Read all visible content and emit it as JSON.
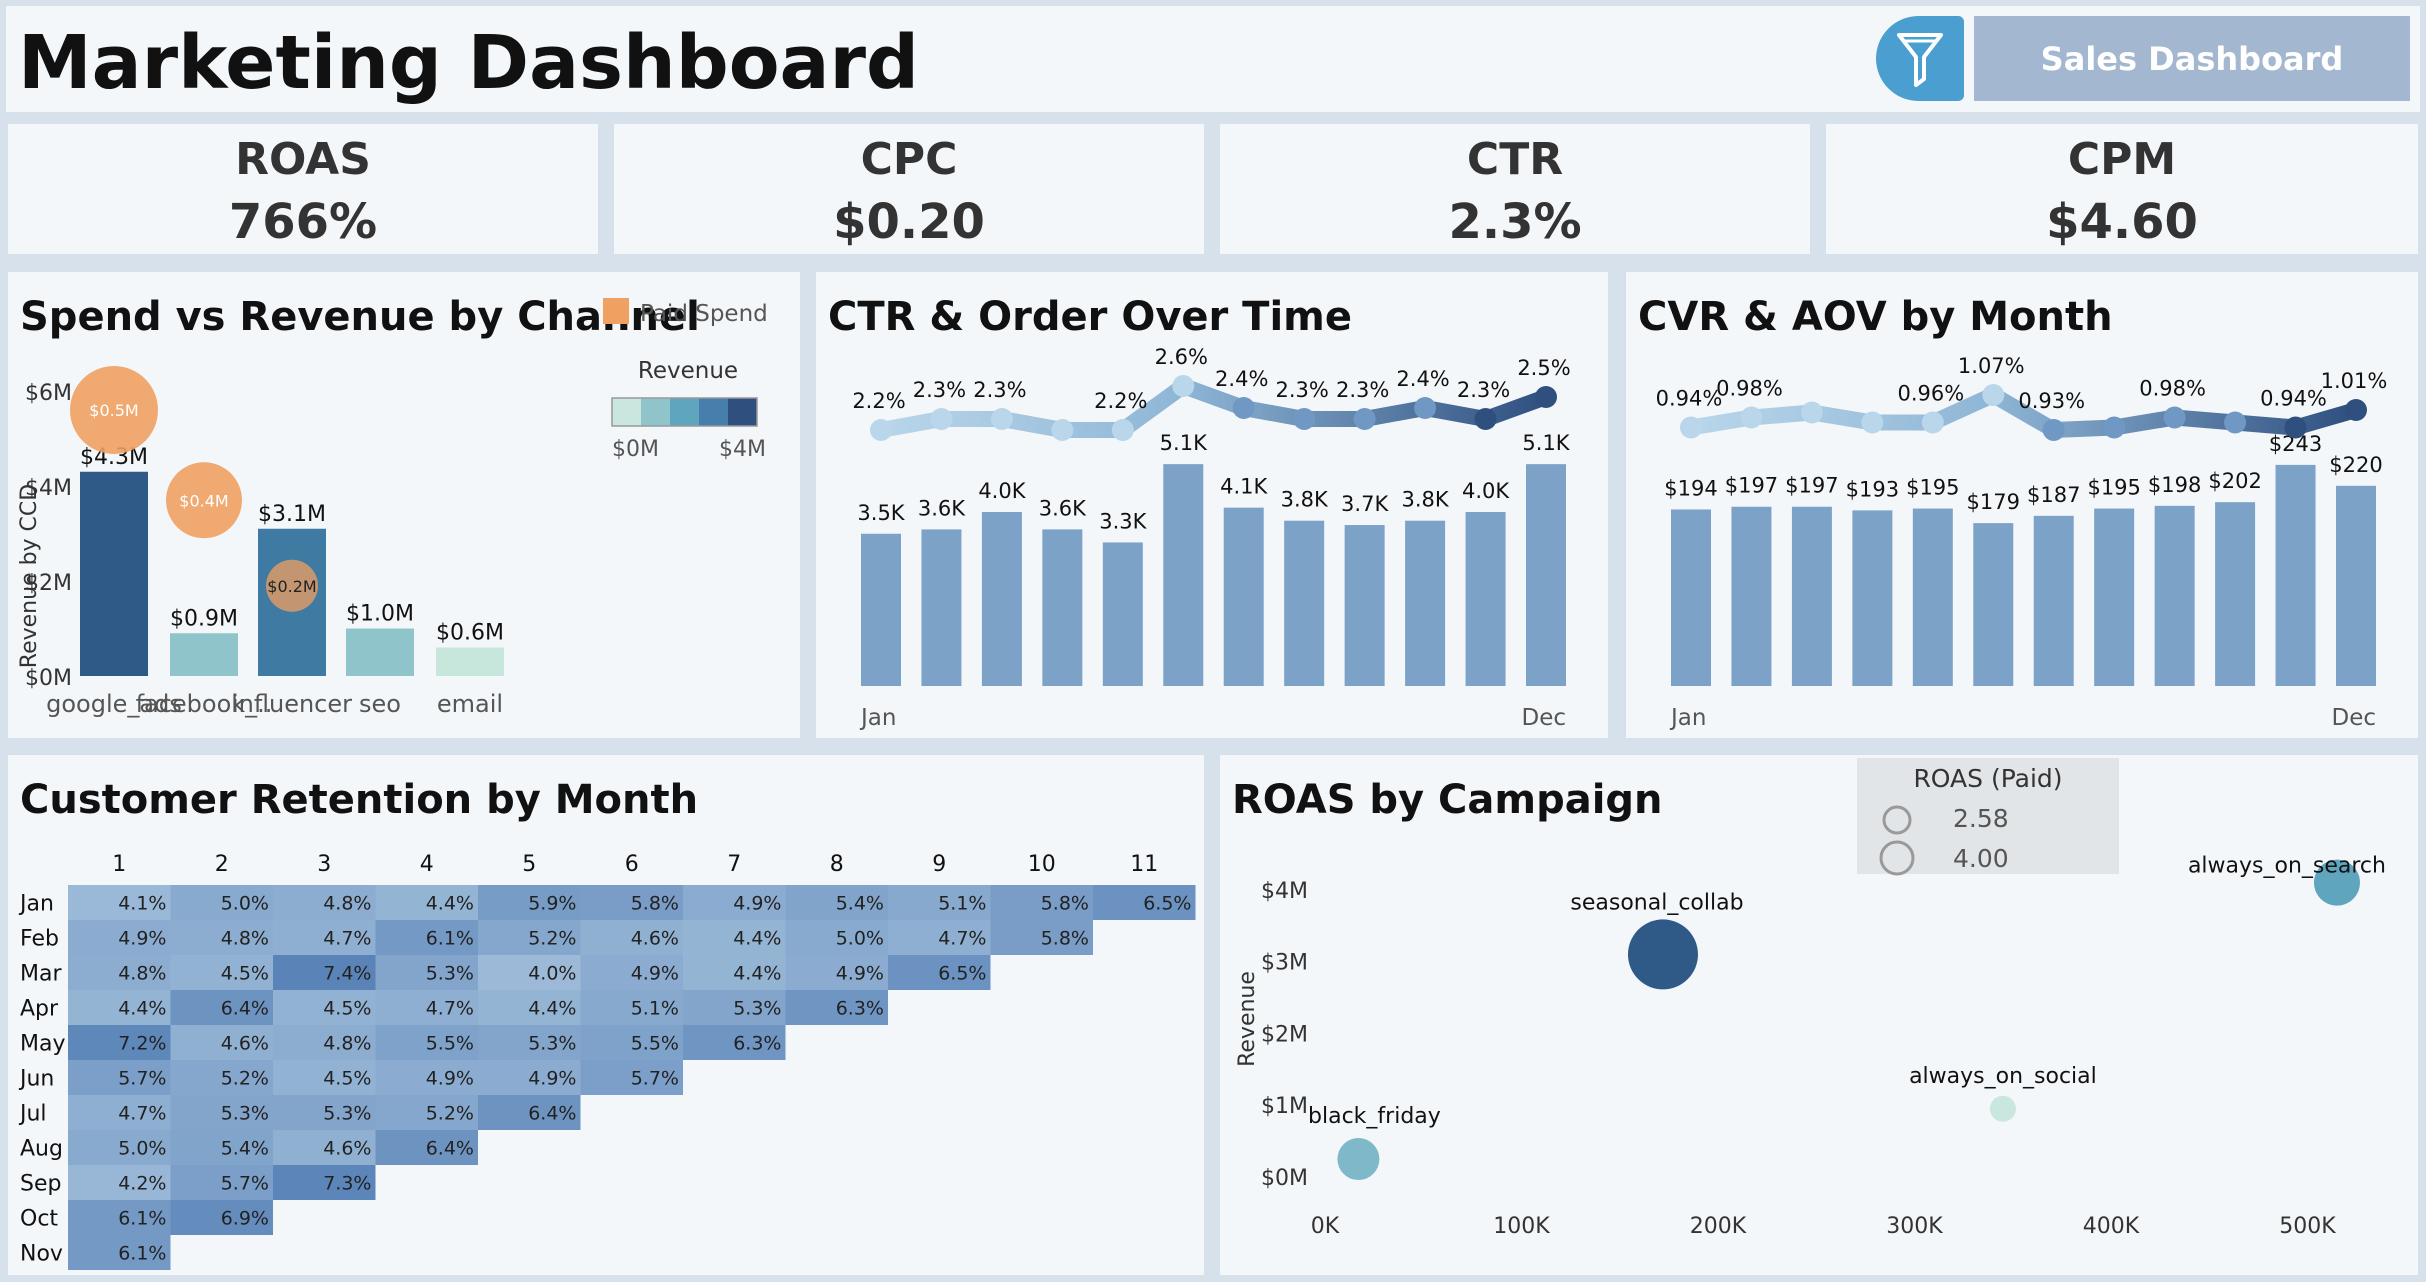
{
  "header": {
    "title": "Marketing Dashboard",
    "nav_button_label": "Sales Dashboard",
    "filter_icon": "funnel-icon"
  },
  "kpis": [
    {
      "label": "ROAS",
      "value": "766%"
    },
    {
      "label": "CPC",
      "value": "$0.20"
    },
    {
      "label": "CTR",
      "value": "2.3%"
    },
    {
      "label": "CPM",
      "value": "$4.60"
    }
  ],
  "colors": {
    "background": "#d6e1ec",
    "panel": "#f4f7fa",
    "bar_blue": "#7da2c8",
    "line_dark": "#2f4f7f",
    "line_light": "#b9d6ea",
    "spend_orange": "#f0a060",
    "nav_button": "#a3b8d0",
    "filter_button": "#4a9fd0"
  },
  "chart_data": [
    {
      "id": "spend_revenue",
      "type": "bar",
      "title": "Spend vs Revenue by Channel",
      "ylabel": "Revenue by CCD",
      "ylim": [
        0,
        6
      ],
      "yticks": [
        {
          "v": 0,
          "label": "$0M"
        },
        {
          "v": 2,
          "label": "$2M"
        },
        {
          "v": 4,
          "label": "$4M"
        },
        {
          "v": 6,
          "label": "$6M"
        }
      ],
      "categories": [
        "google_ads",
        "facebook_..",
        "influencer",
        "seo",
        "email"
      ],
      "revenue": [
        4.3,
        0.9,
        3.1,
        1.0,
        0.6
      ],
      "revenue_labels": [
        "$4.3M",
        "$0.9M",
        "$3.1M",
        "$1.0M",
        "$0.6M"
      ],
      "bar_colors": [
        "#2f5a88",
        "#8fc4cb",
        "#3f7aa3",
        "#8fc4cb",
        "#c7e6dc"
      ],
      "paid_spend": [
        {
          "index": 0,
          "value": 0.5,
          "label": "$0.5M",
          "y": 5.6
        },
        {
          "index": 1,
          "value": 0.4,
          "label": "$0.4M",
          "y": 3.7
        },
        {
          "index": 2,
          "value": 0.2,
          "label": "$0.2M",
          "y": 1.9
        }
      ],
      "legend_spend": "Paid Spend",
      "legend_revenue": "Revenue",
      "legend_revenue_min": "$0M",
      "legend_revenue_max": "$4M",
      "legend_gradient": [
        "#c9e7df",
        "#8fc4cb",
        "#5ea5bd",
        "#467fac",
        "#2f4f7f"
      ],
      "legend": "top-right"
    },
    {
      "id": "ctr_orders",
      "type": "bar",
      "title": "CTR & Order Over Time",
      "x_first": "Jan",
      "x_last": "Dec",
      "orders": [
        3.5,
        3.6,
        4.0,
        3.6,
        3.3,
        5.1,
        4.1,
        3.8,
        3.7,
        3.8,
        4.0,
        5.1
      ],
      "order_labels": [
        "3.5K",
        "3.6K",
        "4.0K",
        "3.6K",
        "3.3K",
        "5.1K",
        "4.1K",
        "3.8K",
        "3.7K",
        "3.8K",
        "4.0K",
        "5.1K"
      ],
      "ctr": [
        2.2,
        2.3,
        2.3,
        2.2,
        2.2,
        2.6,
        2.4,
        2.3,
        2.3,
        2.4,
        2.3,
        2.5
      ],
      "ctr_labels": [
        "2.2%",
        "2.3%",
        "2.3%",
        "",
        "2.2%",
        "2.6%",
        "2.4%",
        "2.3%",
        "2.3%",
        "2.4%",
        "2.3%",
        "2.5%"
      ]
    },
    {
      "id": "cvr_aov",
      "type": "bar",
      "title": "CVR & AOV by Month",
      "x_first": "Jan",
      "x_last": "Dec",
      "aov": [
        194,
        197,
        197,
        193,
        195,
        179,
        187,
        195,
        198,
        202,
        243,
        220
      ],
      "aov_labels": [
        "$194",
        "$197",
        "$197",
        "$193",
        "$195",
        "$179",
        "$187",
        "$195",
        "$198",
        "$202",
        "$243",
        "$220"
      ],
      "cvr": [
        0.94,
        0.98,
        1.0,
        0.96,
        0.96,
        1.07,
        0.93,
        0.94,
        0.98,
        0.96,
        0.94,
        1.01
      ],
      "cvr_labels": [
        "0.94%",
        "0.98%",
        "",
        "",
        "0.96%",
        "1.07%",
        "0.93%",
        "",
        "0.98%",
        "",
        "0.94%",
        "1.01%"
      ]
    },
    {
      "id": "retention",
      "type": "heatmap",
      "title": "Customer Retention by Month",
      "columns": [
        "1",
        "2",
        "3",
        "4",
        "5",
        "6",
        "7",
        "8",
        "9",
        "10",
        "11"
      ],
      "rows": [
        {
          "label": "Jan",
          "cells": [
            "4.1%",
            "5.0%",
            "4.8%",
            "4.4%",
            "5.9%",
            "5.8%",
            "4.9%",
            "5.4%",
            "5.1%",
            "5.8%",
            "6.5%"
          ]
        },
        {
          "label": "Feb",
          "cells": [
            "4.9%",
            "4.8%",
            "4.7%",
            "6.1%",
            "5.2%",
            "4.6%",
            "4.4%",
            "5.0%",
            "4.7%",
            "5.8%"
          ]
        },
        {
          "label": "Mar",
          "cells": [
            "4.8%",
            "4.5%",
            "7.4%",
            "5.3%",
            "4.0%",
            "4.9%",
            "4.4%",
            "4.9%",
            "6.5%"
          ]
        },
        {
          "label": "Apr",
          "cells": [
            "4.4%",
            "6.4%",
            "4.5%",
            "4.7%",
            "4.4%",
            "5.1%",
            "5.3%",
            "6.3%"
          ]
        },
        {
          "label": "May",
          "cells": [
            "7.2%",
            "4.6%",
            "4.8%",
            "5.5%",
            "5.3%",
            "5.5%",
            "6.3%"
          ]
        },
        {
          "label": "Jun",
          "cells": [
            "5.7%",
            "5.2%",
            "4.5%",
            "4.9%",
            "4.9%",
            "5.7%"
          ]
        },
        {
          "label": "Jul",
          "cells": [
            "4.7%",
            "5.3%",
            "5.3%",
            "5.2%",
            "6.4%"
          ]
        },
        {
          "label": "Aug",
          "cells": [
            "5.0%",
            "5.4%",
            "4.6%",
            "6.4%"
          ]
        },
        {
          "label": "Sep",
          "cells": [
            "4.2%",
            "5.7%",
            "7.3%"
          ]
        },
        {
          "label": "Oct",
          "cells": [
            "6.1%",
            "6.9%"
          ]
        },
        {
          "label": "Nov",
          "cells": [
            "6.1%"
          ]
        }
      ]
    },
    {
      "id": "roas_campaign",
      "type": "scatter",
      "title": "ROAS by Campaign",
      "ylabel": "Revenue",
      "xlim": [
        0,
        550000
      ],
      "ylim": [
        0,
        4.4
      ],
      "xticks": [
        {
          "v": 0,
          "label": "0K"
        },
        {
          "v": 100000,
          "label": "100K"
        },
        {
          "v": 200000,
          "label": "200K"
        },
        {
          "v": 300000,
          "label": "300K"
        },
        {
          "v": 400000,
          "label": "400K"
        },
        {
          "v": 500000,
          "label": "500K"
        }
      ],
      "yticks": [
        {
          "v": 0,
          "label": "$0M"
        },
        {
          "v": 1,
          "label": "$1M"
        },
        {
          "v": 2,
          "label": "$2M"
        },
        {
          "v": 3,
          "label": "$3M"
        },
        {
          "v": 4,
          "label": "$4M"
        }
      ],
      "points": [
        {
          "name": "always_on_search",
          "x": 515000,
          "y": 4.1,
          "color": "#5ea5bd"
        },
        {
          "name": "seasonal_collab",
          "x": 172000,
          "y": 3.1,
          "color": "#2f5a88"
        },
        {
          "name": "always_on_social",
          "x": 345000,
          "y": 0.95,
          "color": "#c9e7df"
        },
        {
          "name": "black_friday",
          "x": 17000,
          "y": 0.25,
          "color": "#7fb9c9"
        }
      ],
      "legend_title": "ROAS (Paid)",
      "legend_items": [
        "2.58",
        "4.00"
      ],
      "legend": "top-right"
    }
  ]
}
